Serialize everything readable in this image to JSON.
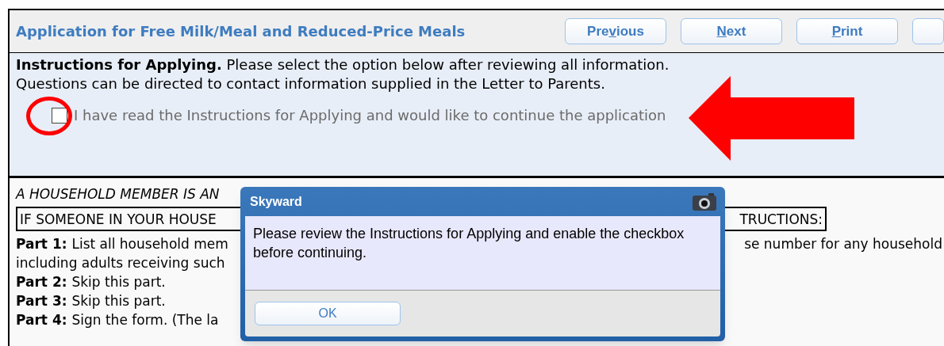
{
  "header": {
    "title": "Application for Free Milk/Meal and Reduced-Price Meals"
  },
  "nav_buttons": [
    {
      "before": "Pre",
      "key": "v",
      "after": "ious"
    },
    {
      "key": "N",
      "after": "ext"
    },
    {
      "key": "P",
      "after": "rint"
    }
  ],
  "instructions": {
    "heading": "Instructions for Applying.",
    "text": "Please select the option below after reviewing all information.",
    "note": "Questions can be directed to contact information supplied in the Letter to Parents.",
    "option": {
      "label": "I have read the Instructions for Applying and would like to continue the application",
      "checked": false,
      "disabled": true
    }
  },
  "details": {
    "italic_line": "A HOUSEHOLD MEMBER IS AN",
    "boxed_left": "IF SOMEONE IN YOUR HOUSE",
    "boxed_right": "TRUCTIONS:",
    "parts": [
      {
        "label": "Part 1:",
        "text": "List all household mem",
        "right_text": "se number for any household"
      },
      {
        "text": "including adults receiving such"
      },
      {
        "label": "Part 2:",
        "text": "Skip this part."
      },
      {
        "label": "Part 3:",
        "text": "Skip this part."
      },
      {
        "label": "Part 4:",
        "text": "Sign the form. (The la"
      }
    ]
  },
  "dialog": {
    "title": "Skyward",
    "message": "Please review the Instructions for Applying and enable the checkbox before continuing.",
    "button": "OK"
  }
}
